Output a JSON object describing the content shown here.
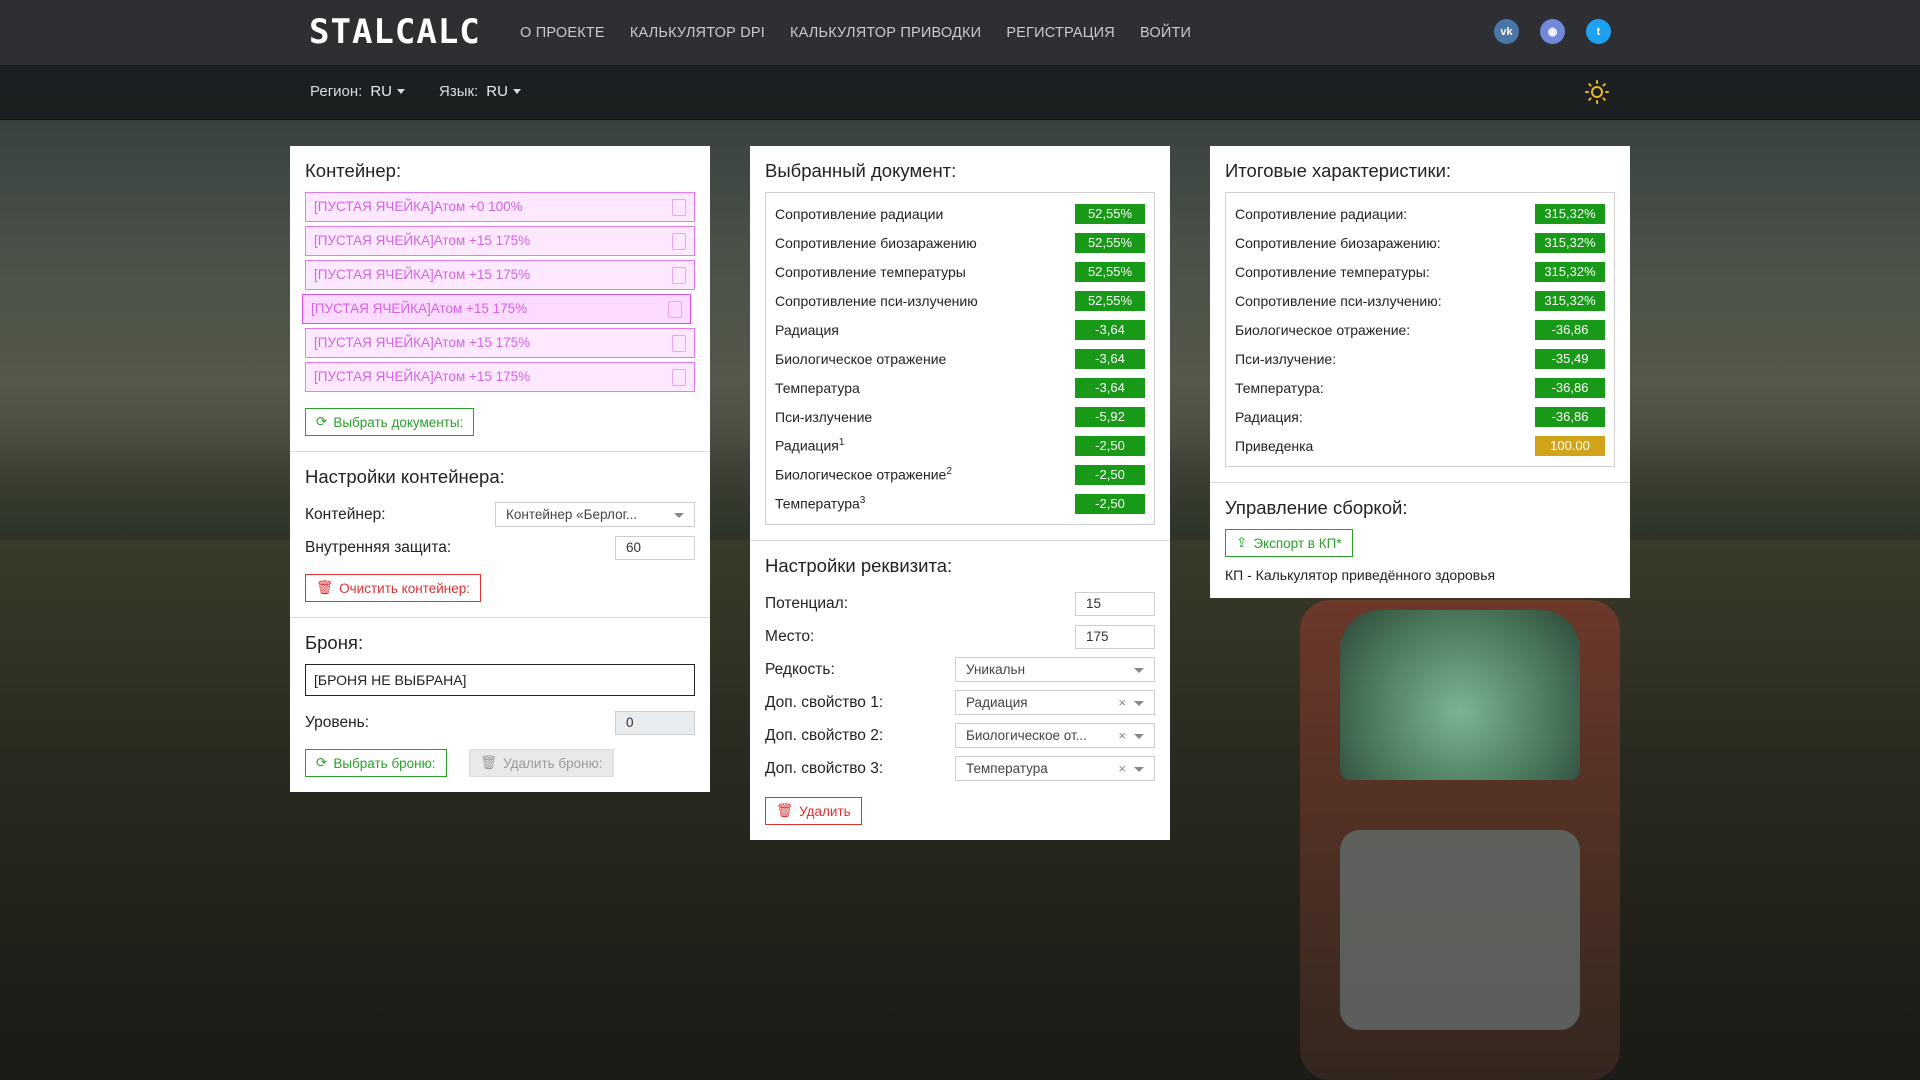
{
  "header": {
    "logo": "STALCALC",
    "nav": [
      "О ПРОЕКТЕ",
      "КАЛЬКУЛЯТОР DPI",
      "КАЛЬКУЛЯТОР ПРИВОДКИ",
      "РЕГИСТРАЦИЯ",
      "ВОЙТИ"
    ],
    "social": [
      {
        "name": "vk-icon",
        "glyph": "vk",
        "color": "#4a76a8"
      },
      {
        "name": "discord-icon",
        "glyph": "◉",
        "color": "#7289da"
      },
      {
        "name": "twitter-icon",
        "glyph": "t",
        "color": "#1da1f2"
      }
    ]
  },
  "subbar": {
    "region_label": "Регион:",
    "region_value": "RU",
    "lang_label": "Язык:",
    "lang_value": "RU"
  },
  "container": {
    "title": "Контейнер:",
    "slots": [
      "[ПУСТАЯ ЯЧЕЙКА]Атом +0 100%",
      "[ПУСТАЯ ЯЧЕЙКА]Атом +15 175%",
      "[ПУСТАЯ ЯЧЕЙКА]Атом +15 175%",
      "[ПУСТАЯ ЯЧЕЙКА]Атом +15 175%",
      "[ПУСТАЯ ЯЧЕЙКА]Атом +15 175%",
      "[ПУСТАЯ ЯЧЕЙКА]Атом +15 175%"
    ],
    "select_docs_btn": "Выбрать документы:"
  },
  "container_settings": {
    "title": "Настройки контейнера:",
    "container_label": "Контейнер:",
    "container_value": "Контейнер «Берлог...",
    "protection_label": "Внутренняя защита:",
    "protection_value": "60",
    "clear_btn": "Очистить контейнер:"
  },
  "armor": {
    "title": "Броня:",
    "value": "[БРОНЯ НЕ ВЫБРАНА]",
    "level_label": "Уровень:",
    "level_value": "0",
    "select_btn": "Выбрать броню:",
    "delete_btn": "Удалить броню:"
  },
  "document": {
    "title": "Выбранный документ:",
    "rows": [
      {
        "label": "Сопротивление радиации",
        "sup": "",
        "value": "52,55%"
      },
      {
        "label": "Сопротивление биозаражению",
        "sup": "",
        "value": "52,55%"
      },
      {
        "label": "Сопротивление температуры",
        "sup": "",
        "value": "52,55%"
      },
      {
        "label": "Сопротивление пси-излучению",
        "sup": "",
        "value": "52,55%"
      },
      {
        "label": "Радиация",
        "sup": "",
        "value": "-3,64"
      },
      {
        "label": "Биологическое отражение",
        "sup": "",
        "value": "-3,64"
      },
      {
        "label": "Температура",
        "sup": "",
        "value": "-3,64"
      },
      {
        "label": "Пси-излучение",
        "sup": "",
        "value": "-5,92"
      },
      {
        "label": "Радиация",
        "sup": "1",
        "value": "-2,50"
      },
      {
        "label": "Биологическое отражение",
        "sup": "2",
        "value": "-2,50"
      },
      {
        "label": "Температура",
        "sup": "3",
        "value": "-2,50"
      }
    ]
  },
  "requisite": {
    "title": "Настройки реквизита:",
    "potential_label": "Потенциал:",
    "potential_value": "15",
    "place_label": "Место:",
    "place_value": "175",
    "rarity_label": "Редкость:",
    "rarity_value": "Уникальн",
    "prop1_label": "Доп. свойство 1:",
    "prop1_value": "Радиация",
    "prop2_label": "Доп. свойство 2:",
    "prop2_value": "Биологическое от...",
    "prop3_label": "Доп. свойство 3:",
    "prop3_value": "Температура",
    "delete_btn": "Удалить"
  },
  "totals": {
    "title": "Итоговые характеристики:",
    "rows": [
      {
        "label": "Сопротивление радиации:",
        "value": "315,32%",
        "color": "#189a18"
      },
      {
        "label": "Сопротивление биозаражению:",
        "value": "315,32%",
        "color": "#189a18"
      },
      {
        "label": "Сопротивление температуры:",
        "value": "315,32%",
        "color": "#189a18"
      },
      {
        "label": "Сопротивление пси-излучению:",
        "value": "315,32%",
        "color": "#189a18"
      },
      {
        "label": "Биологическое отражение:",
        "value": "-36,86",
        "color": "#189a18"
      },
      {
        "label": "Пси-излучение:",
        "value": "-35,49",
        "color": "#189a18"
      },
      {
        "label": "Температура:",
        "value": "-36,86",
        "color": "#189a18"
      },
      {
        "label": "Радиация:",
        "value": "-36,86",
        "color": "#189a18"
      },
      {
        "label": "Приведенка",
        "value": "100.00",
        "color": "#d0a319"
      }
    ]
  },
  "build": {
    "title": "Управление сборкой:",
    "export_btn": "Экспорт в КП*",
    "note": "КП - Калькулятор приведённого здоровья"
  }
}
